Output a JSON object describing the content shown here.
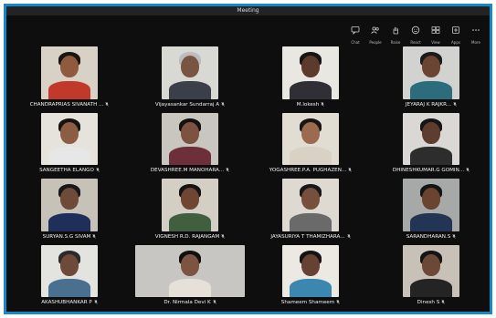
{
  "window": {
    "title": "Meeting"
  },
  "toolbar": [
    {
      "label": "Chat",
      "icon": "chat-icon"
    },
    {
      "label": "People",
      "icon": "people-icon"
    },
    {
      "label": "Raise",
      "icon": "raise-hand-icon"
    },
    {
      "label": "React",
      "icon": "react-icon"
    },
    {
      "label": "View",
      "icon": "view-icon"
    },
    {
      "label": "Apps",
      "icon": "apps-icon"
    },
    {
      "label": "More",
      "icon": "more-icon"
    }
  ],
  "participants": [
    {
      "name": "CHANDRAPRIAS SIVANATH ...",
      "bg": "#d7d1c6",
      "skin": "#8f5a3e",
      "hair": "#1a1412",
      "shirt": "#c0392b"
    },
    {
      "name": "Vijayasankar Sundarraj A",
      "bg": "#d9d9d3",
      "skin": "#7a5443",
      "hair": "#bdbdbd",
      "shirt": "#3b3f4a"
    },
    {
      "name": "M.lokesh",
      "bg": "#e9e7e1",
      "skin": "#5d3b2c",
      "hair": "#151515",
      "shirt": "#2f2f35"
    },
    {
      "name": "JEYARAJ K RAJKR...",
      "bg": "#d2d3d0",
      "skin": "#6b4534",
      "hair": "#1b1b1b",
      "shirt": "#2c6d7d"
    },
    {
      "name": "SANGEETHA ELANGO",
      "bg": "#e6e2dc",
      "skin": "#8c5d45",
      "hair": "#181210",
      "shirt": "#e7e7e7"
    },
    {
      "name": "DEVASHREE.M MANOHARA...",
      "bg": "#c9c6bf",
      "skin": "#7c5340",
      "hair": "#151111",
      "shirt": "#6d2f3a"
    },
    {
      "name": "YOGASHREE.P.A. PUGHAZEN...",
      "bg": "#e2ddd2",
      "skin": "#9a6b4e",
      "hair": "#1a1412",
      "shirt": "#d9d2c4"
    },
    {
      "name": "DHINESHKUMAR.G GOMIN...",
      "bg": "#d9d8d4",
      "skin": "#5e3d2e",
      "hair": "#161616",
      "shirt": "#2d2d2d"
    },
    {
      "name": "SURYAN.S.G SIVAM",
      "bg": "#c7c2b7",
      "skin": "#6e4a38",
      "hair": "#181818",
      "shirt": "#1f2f5a"
    },
    {
      "name": "VIGNESH R.D. RAJANGAM",
      "bg": "#d4cfc4",
      "skin": "#6f4633",
      "hair": "#151515",
      "shirt": "#3f5f3f"
    },
    {
      "name": "JAYASURIYA T THAMIZHARA...",
      "bg": "#dedad2",
      "skin": "#76503c",
      "hair": "#181818",
      "shirt": "#6a6a6a"
    },
    {
      "name": "SARANDHARAN.S",
      "bg": "#a6a9a8",
      "skin": "#6a4331",
      "hair": "#141414",
      "shirt": "#233555"
    },
    {
      "name": "AKASHUBHANKAR P",
      "bg": "#e3e3e0",
      "skin": "#6d4a39",
      "hair": "#2a2a2a",
      "shirt": "#49708e"
    },
    {
      "name": "Dr. Nirmala Devi K",
      "bg": "#c8c6c2",
      "skin": "#7d5442",
      "hair": "#101010",
      "shirt": "#e5e1d9"
    },
    {
      "name": "Shameem Shameem",
      "bg": "#ece9e2",
      "skin": "#654233",
      "hair": "#141414",
      "shirt": "#3b87b0"
    },
    {
      "name": "Dinesh S",
      "bg": "#c7c1b8",
      "skin": "#6c4837",
      "hair": "#141414",
      "shirt": "#242424"
    }
  ]
}
